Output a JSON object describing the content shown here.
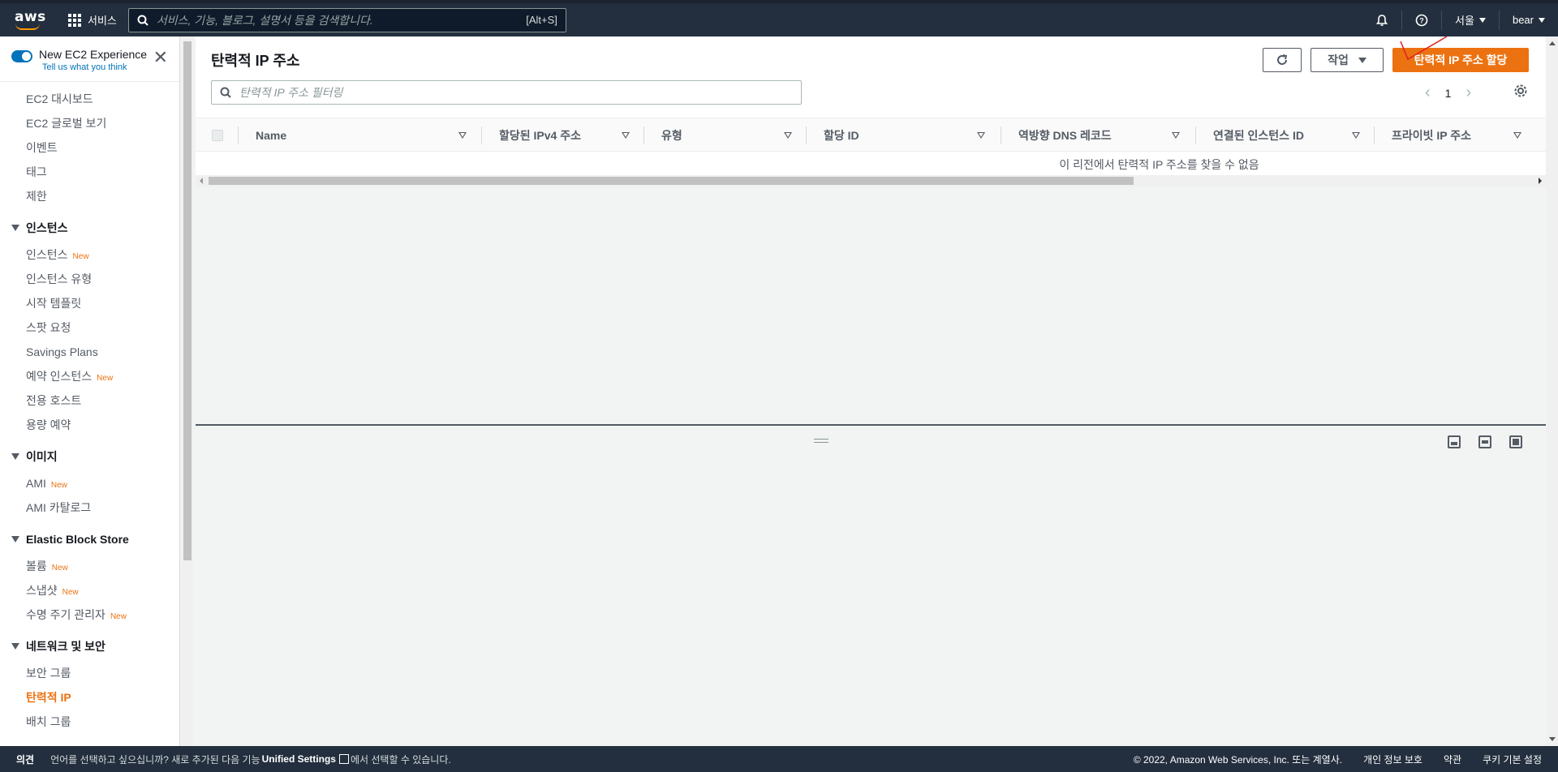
{
  "topnav": {
    "logo_text": "aws",
    "services_label": "서비스",
    "search_placeholder": "서비스, 기능, 블로그, 설명서 등을 검색합니다.",
    "search_shortcut": "[Alt+S]",
    "region_label": "서울",
    "user_label": "bear"
  },
  "sidebar": {
    "experience_label": "New EC2 Experience",
    "experience_sub": "Tell us what you think",
    "top_items": [
      "EC2 대시보드",
      "EC2 글로벌 보기",
      "이벤트",
      "태그",
      "제한"
    ],
    "sections": [
      {
        "title": "인스턴스",
        "items": [
          {
            "label": "인스턴스",
            "badge": "New"
          },
          {
            "label": "인스턴스 유형",
            "badge": ""
          },
          {
            "label": "시작 템플릿",
            "badge": ""
          },
          {
            "label": "스팟 요청",
            "badge": ""
          },
          {
            "label": "Savings Plans",
            "badge": ""
          },
          {
            "label": "예약 인스턴스",
            "badge": "New"
          },
          {
            "label": "전용 호스트",
            "badge": ""
          },
          {
            "label": "용량 예약",
            "badge": ""
          }
        ]
      },
      {
        "title": "이미지",
        "items": [
          {
            "label": "AMI",
            "badge": "New"
          },
          {
            "label": "AMI 카탈로그",
            "badge": ""
          }
        ]
      },
      {
        "title": "Elastic Block Store",
        "items": [
          {
            "label": "볼륨",
            "badge": "New"
          },
          {
            "label": "스냅샷",
            "badge": "New"
          },
          {
            "label": "수명 주기 관리자",
            "badge": "New"
          }
        ]
      },
      {
        "title": "네트워크 및 보안",
        "items": [
          {
            "label": "보안 그룹",
            "badge": ""
          },
          {
            "label": "탄력적 IP",
            "badge": "",
            "active": true
          },
          {
            "label": "배치 그룹",
            "badge": ""
          }
        ]
      }
    ]
  },
  "main": {
    "title": "탄력적 IP 주소",
    "actions_label": "작업",
    "allocate_label": "탄력적 IP 주소 할당",
    "filter_placeholder": "탄력적 IP 주소 필터링",
    "page_number": "1",
    "columns": [
      "Name",
      "할당된 IPv4 주소",
      "유형",
      "할당 ID",
      "역방향 DNS 레코드",
      "연결된 인스턴스 ID",
      "프라이빗 IP 주소"
    ],
    "empty_message": "이 리전에서 탄력적 IP 주소를 찾을 수 없음"
  },
  "footer": {
    "feedback": "의견",
    "lang_text_1": "언어를 선택하고 싶으십니까? 새로 추가된 다음 기능",
    "lang_link": "Unified Settings",
    "lang_text_2": "에서 선택할 수 있습니다.",
    "copyright": "© 2022, Amazon Web Services, Inc. 또는 계열사.",
    "privacy": "개인 정보 보호",
    "terms": "약관",
    "cookies": "쿠키 기본 설정"
  },
  "colors": {
    "nav_bg": "#232f3e",
    "accent": "#ec7211",
    "link": "#0073bb"
  }
}
